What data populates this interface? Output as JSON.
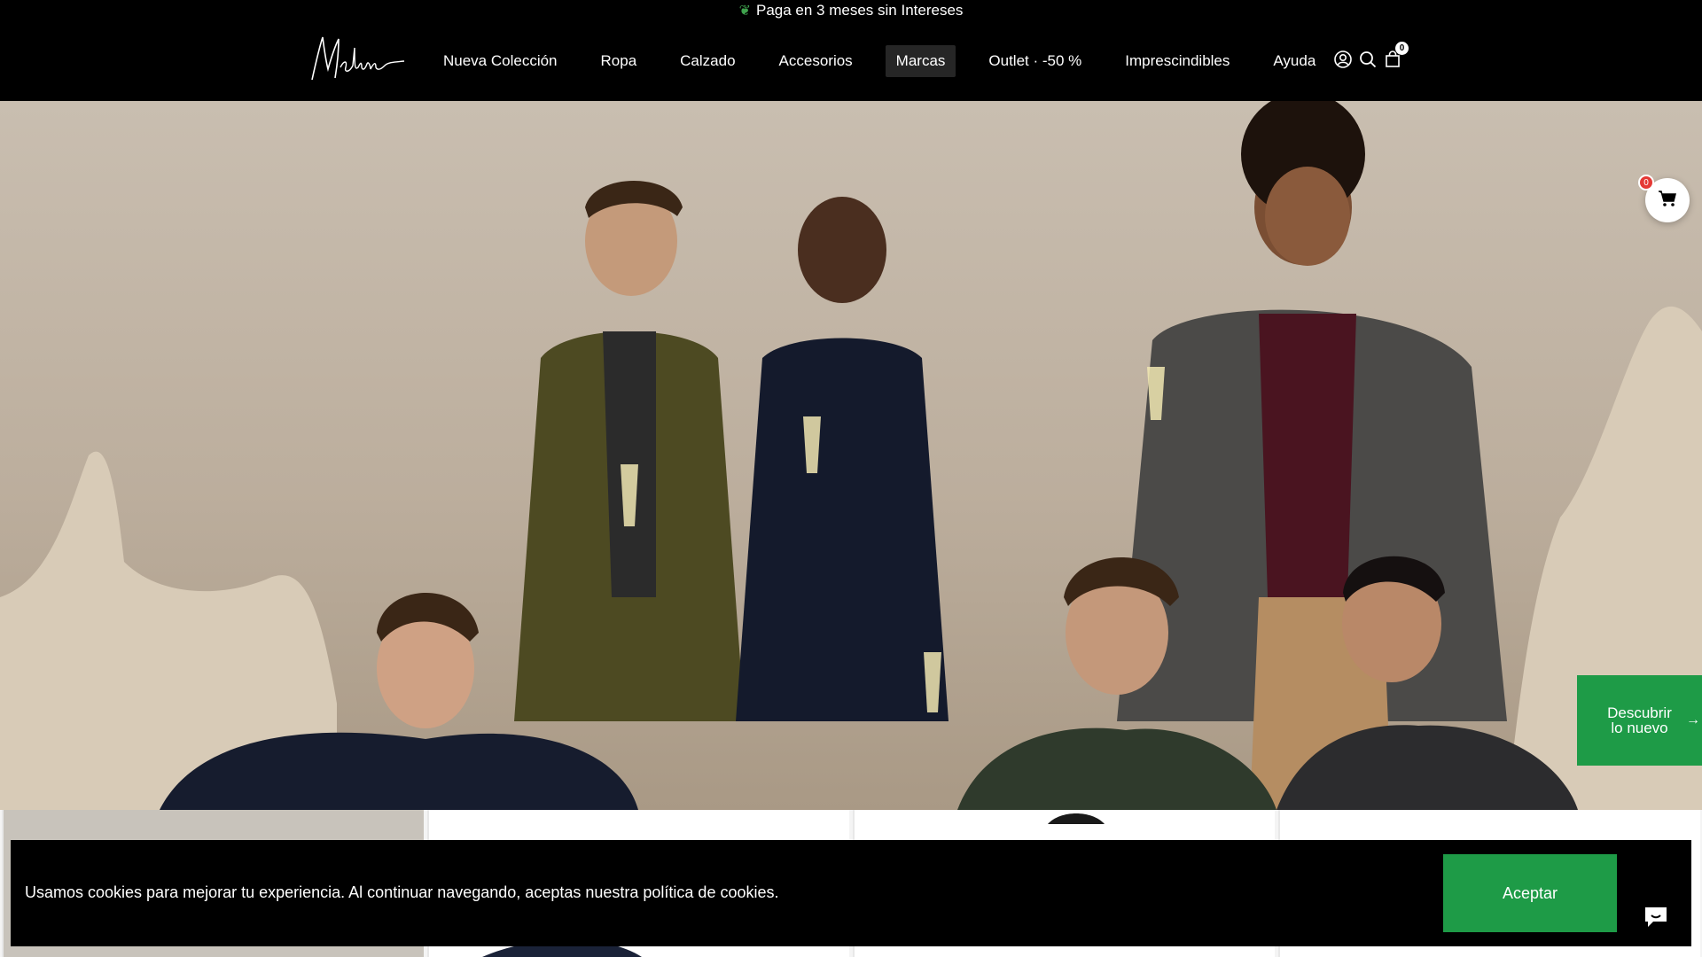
{
  "announcement": {
    "icon": "leaf-icon",
    "text": "Paga en 3 meses sin Intereses"
  },
  "header": {
    "logo_text": "Medina",
    "nav": [
      {
        "label": "Nueva Colección"
      },
      {
        "label": "Ropa"
      },
      {
        "label": "Calzado"
      },
      {
        "label": "Accesorios"
      },
      {
        "label": "Marcas",
        "active": true
      },
      {
        "label": "Outlet · -50 %"
      },
      {
        "label": "Imprescindibles"
      },
      {
        "label": "Ayuda"
      }
    ],
    "icons": [
      "account-icon",
      "search-icon",
      "cart-icon"
    ],
    "cart_count": "0"
  },
  "floating_cart": {
    "count": "0",
    "icon": "cart-icon"
  },
  "side_tab": {
    "line1": "Descubrir",
    "line2": "lo nuevo",
    "icon": "arrow-right-icon",
    "color": "#1e9b47"
  },
  "cookie": {
    "text": "Usamos cookies para mejorar tu experiencia. Al continuar navegando, aceptas nuestra política de cookies.",
    "button": "Aceptar",
    "button_color": "#1e9b47"
  },
  "chat": {
    "icon": "chat-icon"
  }
}
